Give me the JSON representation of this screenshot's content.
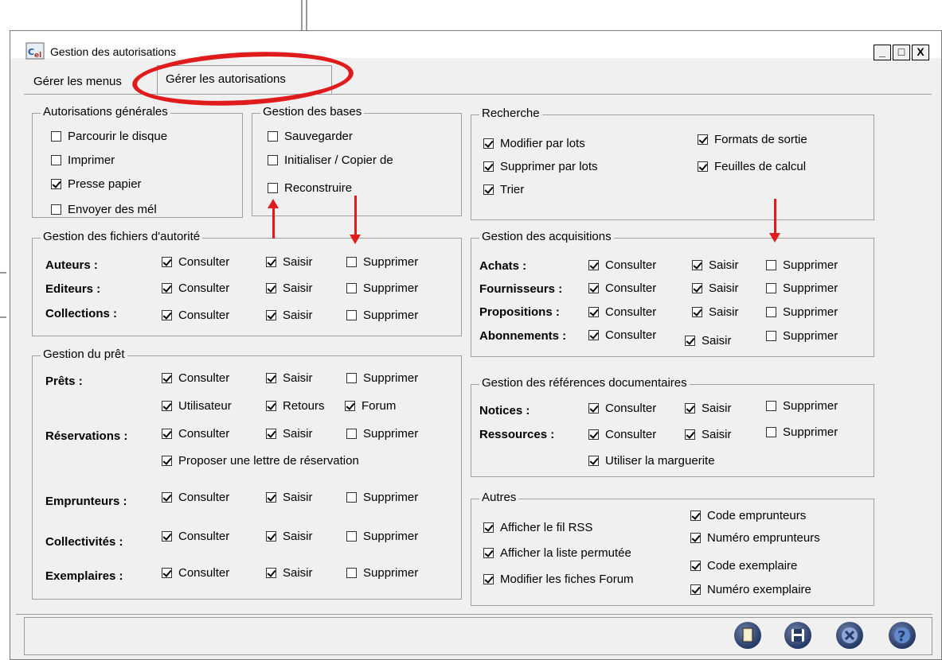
{
  "window": {
    "title": "Gestion des autorisations",
    "controls": {
      "minimize": "_",
      "maximize": "□",
      "close": "X"
    }
  },
  "tabs": [
    {
      "label": "Gérer les menus",
      "active": false
    },
    {
      "label": "Gérer les autorisations",
      "active": true
    }
  ],
  "groups": {
    "generales": {
      "title": "Autorisations générales",
      "items": [
        {
          "label": "Parcourir le disque",
          "checked": false
        },
        {
          "label": "Imprimer",
          "checked": false
        },
        {
          "label": "Presse papier",
          "checked": true
        },
        {
          "label": "Envoyer des mél",
          "checked": false
        }
      ]
    },
    "bases": {
      "title": "Gestion des bases",
      "items": [
        {
          "label": "Sauvegarder",
          "checked": false
        },
        {
          "label": "Initialiser / Copier de",
          "checked": false
        },
        {
          "label": "Reconstruire",
          "checked": false
        }
      ]
    },
    "recherche": {
      "title": "Recherche",
      "items": [
        {
          "label": "Modifier par lots",
          "checked": true
        },
        {
          "label": "Supprimer par lots",
          "checked": true
        },
        {
          "label": "Trier",
          "checked": true
        },
        {
          "label": "Formats de sortie",
          "checked": true
        },
        {
          "label": "Feuilles de calcul",
          "checked": true
        }
      ]
    },
    "autorite": {
      "title": "Gestion des fichiers d'autorité",
      "rows": [
        {
          "label": "Auteurs :",
          "consulter": true,
          "saisir": true,
          "supprimer": false
        },
        {
          "label": "Editeurs :",
          "consulter": true,
          "saisir": true,
          "supprimer": false
        },
        {
          "label": "Collections :",
          "consulter": true,
          "saisir": true,
          "supprimer": false
        }
      ]
    },
    "acquisitions": {
      "title": "Gestion des acquisitions",
      "rows": [
        {
          "label": "Achats :",
          "consulter": true,
          "saisir": true,
          "supprimer": false
        },
        {
          "label": "Fournisseurs :",
          "consulter": true,
          "saisir": true,
          "supprimer": false
        },
        {
          "label": "Propositions :",
          "consulter": true,
          "saisir": true,
          "supprimer": false
        },
        {
          "label": "Abonnements :",
          "consulter": true,
          "saisir": true,
          "supprimer": false
        }
      ]
    },
    "pret": {
      "title": "Gestion du prêt",
      "prets_label": "Prêts :",
      "reservations_label": "Réservations :",
      "emprunteurs_label": "Emprunteurs :",
      "collectivites_label": "Collectivités :",
      "exemplaires_label": "Exemplaires :",
      "utilisateur": "Utilisateur",
      "retours": "Retours",
      "forum": "Forum",
      "lettre": "Proposer une lettre de réservation"
    },
    "references": {
      "title": "Gestion des références documentaires",
      "notices_label": "Notices :",
      "ressources_label": "Ressources :",
      "marguerite": "Utiliser la marguerite"
    },
    "autres": {
      "title": "Autres",
      "items": [
        {
          "label": "Afficher le fil RSS",
          "checked": true
        },
        {
          "label": "Afficher la liste permutée",
          "checked": true
        },
        {
          "label": "Modifier les fiches Forum",
          "checked": true
        },
        {
          "label": "Code emprunteurs",
          "checked": true
        },
        {
          "label": "Numéro emprunteurs",
          "checked": true
        },
        {
          "label": "Code exemplaire",
          "checked": true
        },
        {
          "label": "Numéro exemplaire",
          "checked": true
        }
      ]
    }
  },
  "common": {
    "consulter": "Consulter",
    "saisir": "Saisir",
    "supprimer": "Supprimer"
  },
  "colors": {
    "annotation": "#e01b1b",
    "button": "#263a66"
  }
}
